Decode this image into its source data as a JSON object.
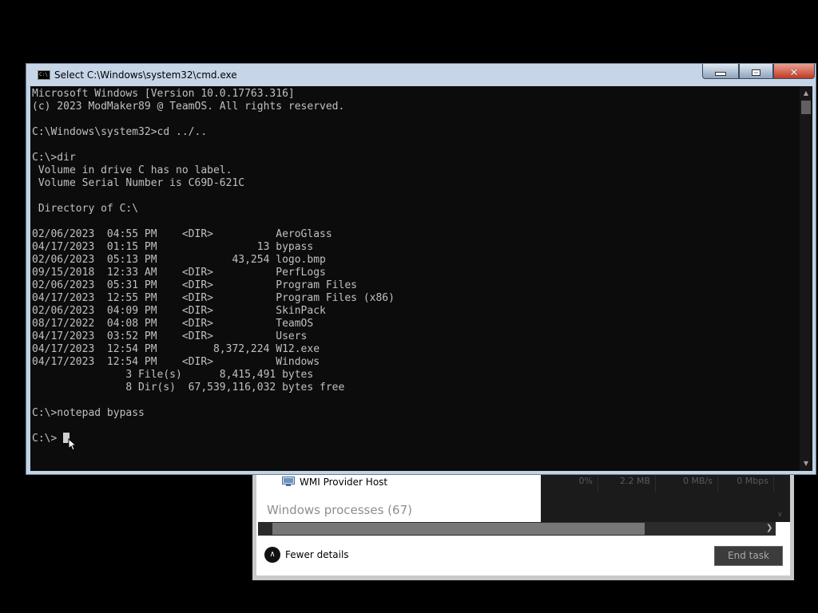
{
  "task_manager": {
    "process_row": {
      "name": "WMI Provider Host",
      "cpu": "0%",
      "memory": "2.2 MB",
      "disk": "0 MB/s",
      "network": "0 Mbps"
    },
    "section_heading": "Windows processes (67)",
    "fewer_details_label": "Fewer details",
    "end_task_label": "End task"
  },
  "cmd_window": {
    "title": "Select C:\\Windows\\system32\\cmd.exe",
    "icon_label": "C:\\",
    "controls": {
      "minimize": "minimize",
      "maximize": "maximize",
      "close": "✕"
    },
    "lines": [
      "Microsoft Windows [Version 10.0.17763.316]",
      "(c) 2023 ModMaker89 @ TeamOS. All rights reserved.",
      "",
      "C:\\Windows\\system32>cd ../..",
      "",
      "C:\\>dir",
      " Volume in drive C has no label.",
      " Volume Serial Number is C69D-621C",
      "",
      " Directory of C:\\",
      "",
      "02/06/2023  04:55 PM    <DIR>          AeroGlass",
      "04/17/2023  01:15 PM                13 bypass",
      "02/06/2023  05:13 PM            43,254 logo.bmp",
      "09/15/2018  12:33 AM    <DIR>          PerfLogs",
      "02/06/2023  05:31 PM    <DIR>          Program Files",
      "04/17/2023  12:55 PM    <DIR>          Program Files (x86)",
      "02/06/2023  04:09 PM    <DIR>          SkinPack",
      "08/17/2022  04:08 PM    <DIR>          TeamOS",
      "04/17/2023  03:52 PM    <DIR>          Users",
      "04/17/2023  12:54 PM         8,372,224 W12.exe",
      "04/17/2023  12:54 PM    <DIR>          Windows",
      "               3 File(s)      8,415,491 bytes",
      "               8 Dir(s)  67,539,116,032 bytes free",
      "",
      "C:\\>notepad bypass",
      ""
    ],
    "prompt": "C:\\> "
  },
  "colors": {
    "console_bg": "#0c0c0c",
    "console_fg": "#c0c0c0",
    "titlebar": "#c6d6e8",
    "close_button": "#c23a24"
  }
}
